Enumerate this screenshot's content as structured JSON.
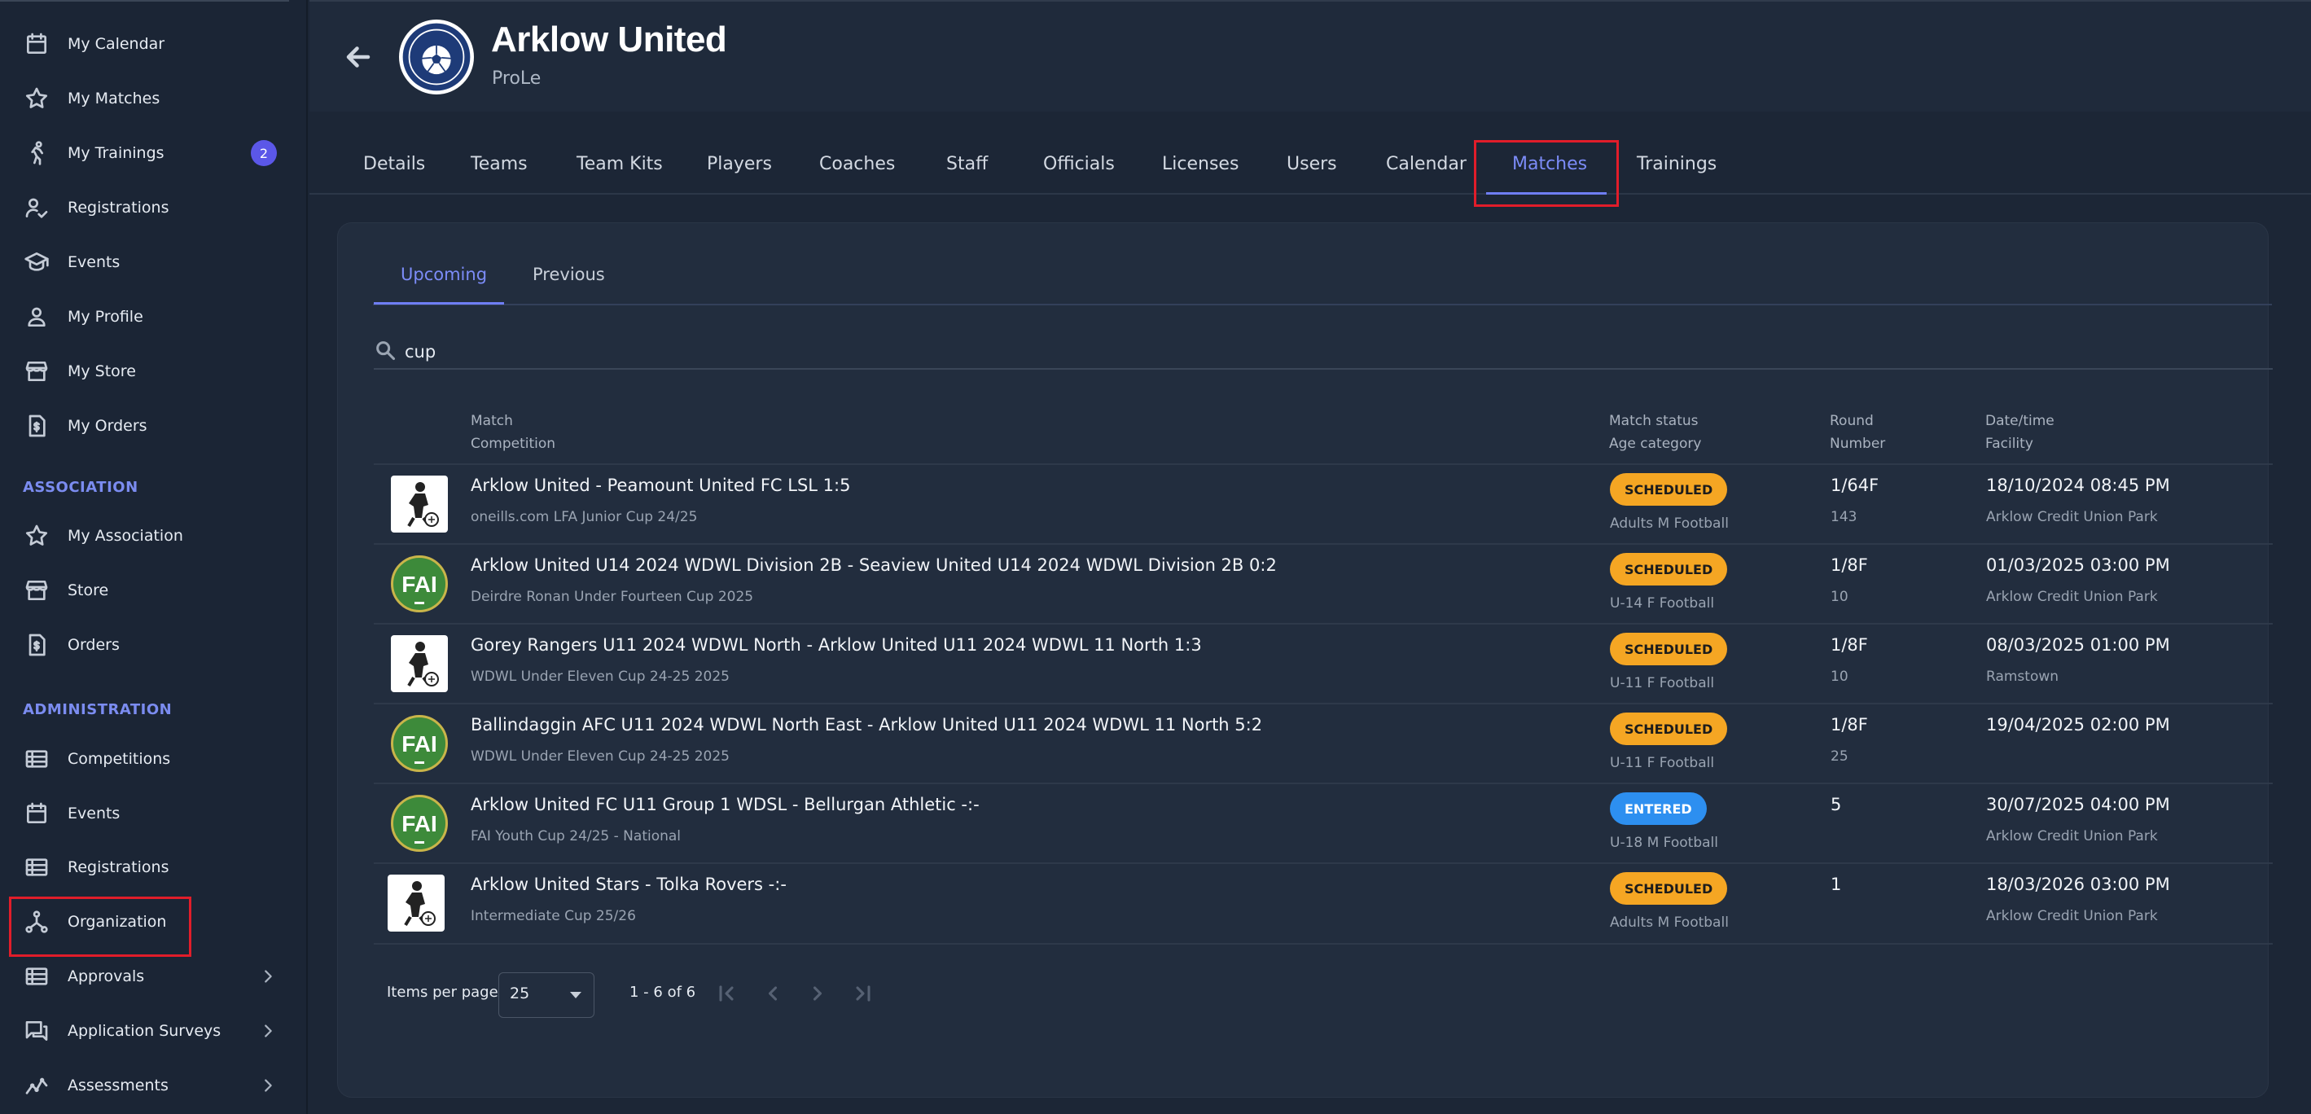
{
  "sidebar": {
    "items": [
      {
        "label": "My Calendar",
        "icon": "calendar-icon"
      },
      {
        "label": "My Matches",
        "icon": "star-icon"
      },
      {
        "label": "My Trainings",
        "icon": "running-icon",
        "badge": "2"
      },
      {
        "label": "Registrations",
        "icon": "user-check-icon"
      },
      {
        "label": "Events",
        "icon": "graduation-cap-icon"
      },
      {
        "label": "My Profile",
        "icon": "person-icon"
      },
      {
        "label": "My Store",
        "icon": "store-icon"
      },
      {
        "label": "My Orders",
        "icon": "invoice-icon"
      }
    ],
    "association_title": "ASSOCIATION",
    "association_items": [
      {
        "label": "My Association",
        "icon": "star-icon"
      },
      {
        "label": "Store",
        "icon": "store-icon"
      },
      {
        "label": "Orders",
        "icon": "invoice-icon"
      }
    ],
    "administration_title": "ADMINISTRATION",
    "administration_items": [
      {
        "label": "Competitions",
        "icon": "list-icon"
      },
      {
        "label": "Events",
        "icon": "calendar-icon"
      },
      {
        "label": "Registrations",
        "icon": "list-icon"
      },
      {
        "label": "Organization",
        "icon": "hierarchy-icon"
      },
      {
        "label": "Approvals",
        "icon": "list-icon"
      },
      {
        "label": "Application Surveys",
        "icon": "chat-icon"
      },
      {
        "label": "Assessments",
        "icon": "trend-icon"
      }
    ]
  },
  "header": {
    "title": "Arklow United",
    "subtitle": "ProLe"
  },
  "tabs": [
    "Details",
    "Teams",
    "Team Kits",
    "Players",
    "Coaches",
    "Staff",
    "Officials",
    "Licenses",
    "Users",
    "Calendar",
    "Matches",
    "Trainings"
  ],
  "active_tab": "Matches",
  "subtabs": [
    "Upcoming",
    "Previous"
  ],
  "search": {
    "value": "cup"
  },
  "columns": {
    "match": "Match",
    "competition": "Competition",
    "status": "Match status",
    "age": "Age category",
    "round": "Round",
    "number": "Number",
    "datetime": "Date/time",
    "facility": "Facility"
  },
  "rows": [
    {
      "logo": "player-logo",
      "match": "Arklow United - Peamount United FC LSL 1:5",
      "competition": "oneills.com LFA Junior Cup 24/25",
      "status": "SCHEDULED",
      "age": "Adults M Football",
      "round": "1/64F",
      "number": "143",
      "datetime": "18/10/2024 08:45 PM",
      "facility": "Arklow Credit Union Park"
    },
    {
      "logo": "fai-logo",
      "match": "Arklow United U14 2024 WDWL Division 2B - Seaview United U14 2024 WDWL Division 2B 0:2",
      "competition": "Deirdre Ronan Under Fourteen Cup 2025",
      "status": "SCHEDULED",
      "age": "U-14 F Football",
      "round": "1/8F",
      "number": "10",
      "datetime": "01/03/2025 03:00 PM",
      "facility": "Arklow Credit Union Park"
    },
    {
      "logo": "player-logo",
      "match": "Gorey Rangers U11 2024 WDWL North - Arklow United U11 2024 WDWL 11 North 1:3",
      "competition": "WDWL Under Eleven Cup 24-25 2025",
      "status": "SCHEDULED",
      "age": "U-11 F Football",
      "round": "1/8F",
      "number": "10",
      "datetime": "08/03/2025 01:00 PM",
      "facility": "Ramstown"
    },
    {
      "logo": "fai-logo",
      "match": "Ballindaggin AFC U11 2024 WDWL North East - Arklow United U11 2024 WDWL 11 North 5:2",
      "competition": "WDWL Under Eleven Cup 24-25 2025",
      "status": "SCHEDULED",
      "age": "U-11 F Football",
      "round": "1/8F",
      "number": "25",
      "datetime": "19/04/2025 02:00 PM",
      "facility": ""
    },
    {
      "logo": "fai-logo",
      "match": "Arklow United FC U11 Group 1 WDSL - Bellurgan Athletic -:-",
      "competition": "FAI Youth Cup 24/25 - National",
      "status": "ENTERED",
      "age": "U-18 M Football",
      "round": "5",
      "number": "",
      "datetime": "30/07/2025 04:00 PM",
      "facility": "Arklow Credit Union Park"
    },
    {
      "logo": "player-logo",
      "match": "Arklow United Stars - Tolka Rovers -:-",
      "competition": "Intermediate Cup 25/26",
      "status": "SCHEDULED",
      "age": "Adults M Football",
      "round": "1",
      "number": "",
      "datetime": "18/03/2026 03:00 PM",
      "facility": "Arklow Credit Union Park"
    }
  ],
  "pagination": {
    "items_label": "Items per page",
    "page_size": "25",
    "range": "1 - 6 of 6"
  },
  "colors": {
    "accent": "#7c8cf8",
    "scheduled": "#f5a623",
    "entered": "#2d8ff0",
    "highlight": "#e11d2a"
  }
}
